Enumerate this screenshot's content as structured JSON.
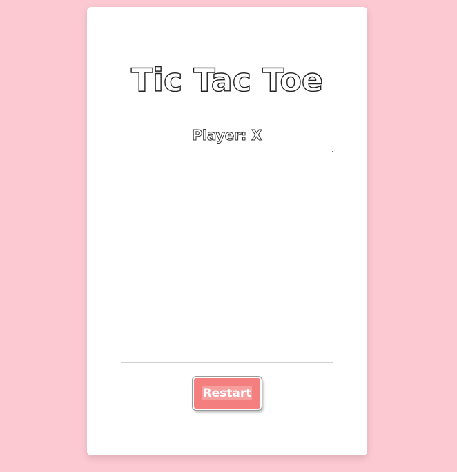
{
  "game": {
    "title": "Tic Tac Toe",
    "player_status": "Player: X",
    "board": [
      "",
      "",
      "",
      "",
      "",
      "",
      "",
      "",
      ""
    ],
    "restart_label": "Restart"
  },
  "colors": {
    "background": "#fcc8d1",
    "card": "#ffffff",
    "button": "#f47f7f"
  }
}
